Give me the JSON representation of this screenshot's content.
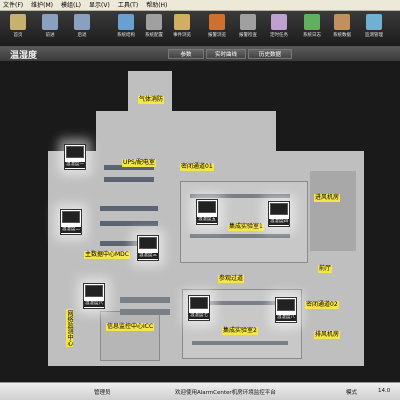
{
  "menu": [
    "文件(F)",
    "维护(M)",
    "模组(L)",
    "显示(V)",
    "工具(T)",
    "帮助(H)"
  ],
  "toolbar": [
    {
      "label": "首页",
      "color": "#c8b070"
    },
    {
      "label": "前进",
      "color": "#8aa0c0"
    },
    {
      "label": "后退",
      "color": "#8aa0c0"
    },
    {
      "label": "系统结构",
      "color": "#6aa0d0"
    },
    {
      "label": "系统配置",
      "color": "#a0a0a0"
    },
    {
      "label": "事件浏览",
      "color": "#d0b060"
    },
    {
      "label": "报警浏览",
      "color": "#d07030"
    },
    {
      "label": "报警检查",
      "color": "#a0a0a0"
    },
    {
      "label": "定时任务",
      "color": "#c0a0d0"
    },
    {
      "label": "系统日志",
      "color": "#60b060"
    },
    {
      "label": "系统数据",
      "color": "#c09060"
    },
    {
      "label": "监测管理",
      "color": "#70b0d0"
    }
  ],
  "header": {
    "title": "温湿度",
    "tabs": [
      "参数",
      "实时曲线",
      "历史数据"
    ]
  },
  "map": {
    "labels": {
      "gas_room": "气体消防",
      "ups_room": "UPS/配电室",
      "corridor1": "密闭通道01",
      "lab1": "集成实验室1",
      "main_room": "主数据中心MDC",
      "zone_exit": "参观过道",
      "front_room": "前厅",
      "back_room": "进风机房",
      "info_center": "信息监控中心ICC",
      "lab2": "集成实验室2",
      "corridor2": "密闭通道02",
      "exhaust_room": "排风机房",
      "left_vertical": "网络监测中心"
    },
    "sensors": [
      {
        "name": "温湿度一"
      },
      {
        "name": "温湿度二"
      },
      {
        "name": "温湿度三"
      },
      {
        "name": "温湿度五"
      },
      {
        "name": "温湿度四"
      },
      {
        "name": "温湿度六"
      },
      {
        "name": "温湿度七"
      },
      {
        "name": "温湿度八"
      }
    ]
  },
  "status": {
    "user": "管理员",
    "message": "欢迎使用AlarmCenter机房环境监控平台",
    "mode": "模式",
    "version": "14.0"
  }
}
